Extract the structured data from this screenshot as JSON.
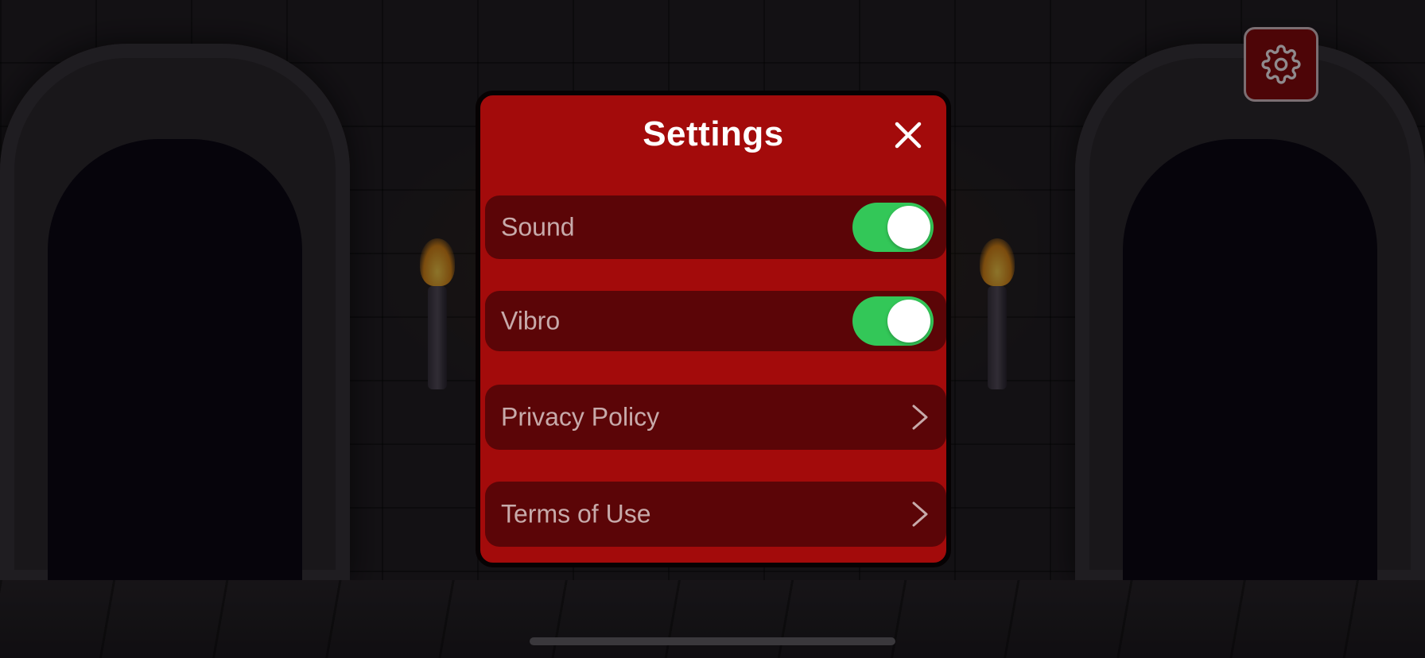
{
  "modal": {
    "title": "Settings",
    "rows": [
      {
        "label": "Sound",
        "type": "toggle",
        "on": true
      },
      {
        "label": "Vibro",
        "type": "toggle",
        "on": true
      },
      {
        "label": "Privacy Policy",
        "type": "link"
      },
      {
        "label": "Terms of Use",
        "type": "link"
      }
    ]
  },
  "icons": {
    "settings": "gear-icon",
    "close": "close-icon",
    "chevron": "chevron-right-icon"
  },
  "colors": {
    "modal_bg": "#a30b0b",
    "row_bg": "#5b0507",
    "toggle_on": "#33c758",
    "row_text": "#c7aaaa",
    "title_text": "#ffffff"
  }
}
